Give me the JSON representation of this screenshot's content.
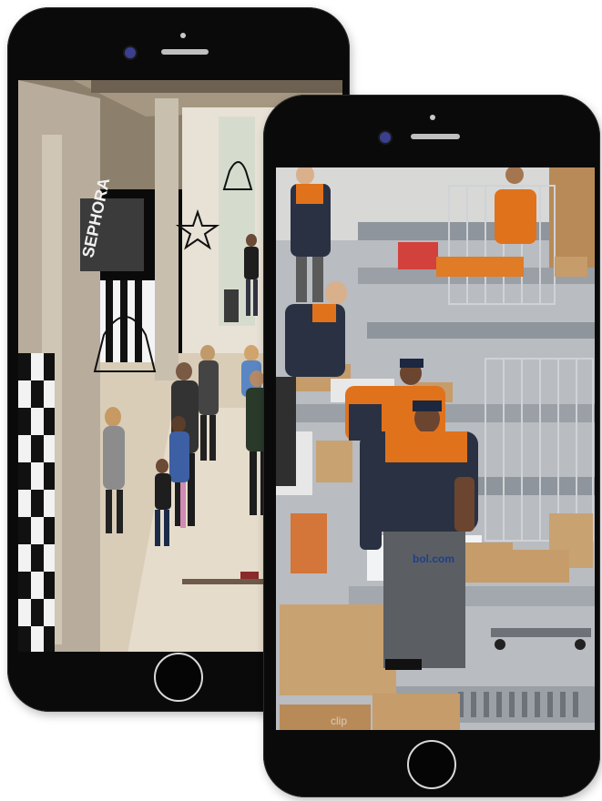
{
  "scene": {
    "description_free": true,
    "mall_screen": {
      "store_sign": "SEPHORA",
      "colors": {
        "floor": "#d9cdb8",
        "wall": "#b8ad9c",
        "ceiling": "#8c7f6c",
        "checker_dark": "#111111",
        "checker_light": "#f2f2f2"
      }
    },
    "warehouse_screen": {
      "box_label": "bol.com",
      "watermark": "clip",
      "colors": {
        "uniform_orange": "#e0721c",
        "uniform_navy": "#2a3142",
        "cardboard": "#c59c6a",
        "conveyor": "#8f959c"
      }
    }
  },
  "icons": {
    "back_camera": "front-camera-icon",
    "front_camera": "front-camera-icon",
    "home_button": "home-button-icon"
  }
}
